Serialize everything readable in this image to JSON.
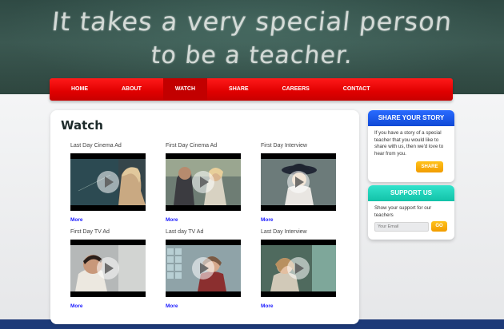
{
  "header": {
    "chalk_line_1": "It takes a very special person",
    "chalk_line_2": "to be a teacher."
  },
  "nav": {
    "items": [
      {
        "label": "HOME"
      },
      {
        "label": "ABOUT"
      },
      {
        "label": "WATCH",
        "active": true
      },
      {
        "label": "SHARE"
      },
      {
        "label": "CAREERS"
      },
      {
        "label": "CONTACT"
      }
    ]
  },
  "main": {
    "title": "Watch",
    "more_label": "More",
    "videos": [
      {
        "title": "Last Day Cinema Ad"
      },
      {
        "title": "First Day Cinema Ad"
      },
      {
        "title": "First Day Interview"
      },
      {
        "title": "First Day TV Ad"
      },
      {
        "title": "Last day TV Ad"
      },
      {
        "title": "Last Day Interview"
      }
    ]
  },
  "sidebar": {
    "share_story": {
      "title": "SHARE YOUR STORY",
      "text": "If you have a story of a special teacher that you would like to share with us, then we'd love to hear from you.",
      "button": "SHARE"
    },
    "support": {
      "title": "SUPPORT US",
      "text": "Show your support for our teachers",
      "email_placeholder": "Your Email",
      "button": "GO"
    }
  },
  "colors": {
    "nav_red": "#e00000",
    "share_blue": "#1a55e8",
    "support_teal": "#1fd0b6",
    "button_orange": "#f7a800",
    "footer_navy": "#1d3a78"
  }
}
